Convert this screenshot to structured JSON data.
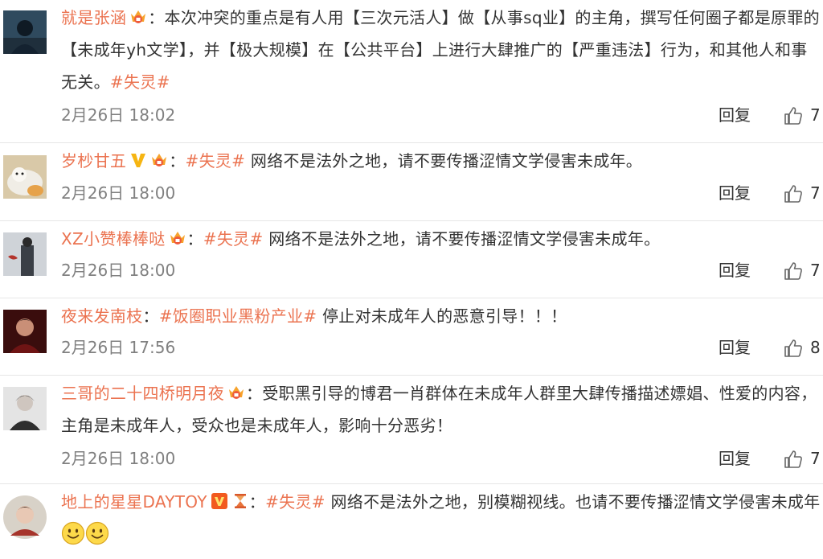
{
  "colors": {
    "username": "#eb7350",
    "topic": "#eb7350",
    "text": "#333333",
    "time": "#808080",
    "divider": "#e6e6e6"
  },
  "comments": [
    {
      "username": "就是张涵",
      "badges": [
        "fan-crown-badge"
      ],
      "separator": "：",
      "text_before": "本次冲突的重点是有人用【三次元活人】做【从事sq业】的主角，撰写任何圈子都是原罪的【未成年yh文学】，并【极大规模】在【公共平台】上进行大肆推广的【严重违法】行为，和其他人和事无关。",
      "topic": "#失灵#",
      "text_after": "",
      "time": "2月26日 18:02",
      "reply_label": "回复",
      "likes": "7"
    },
    {
      "username": "岁杪甘五",
      "badges": [
        "verified-v-badge",
        "fan-crown-badge"
      ],
      "separator": "：",
      "text_before": "",
      "topic": "#失灵#",
      "text_after": " 网络不是法外之地，请不要传播涩情文学侵害未成年。",
      "time": "2月26日 18:00",
      "reply_label": "回复",
      "likes": "7"
    },
    {
      "username": "XZ小赞棒棒哒",
      "badges": [
        "fan-crown-badge"
      ],
      "separator": "：",
      "text_before": "",
      "topic": "#失灵#",
      "text_after": " 网络不是法外之地，请不要传播涩情文学侵害未成年。",
      "time": "2月26日 18:00",
      "reply_label": "回复",
      "likes": "7"
    },
    {
      "username": "夜来发南枝",
      "badges": [],
      "separator": "：",
      "text_before": "",
      "topic": "#饭圈职业黑粉产业#",
      "text_after": " 停止对未成年人的恶意引导！！！",
      "time": "2月26日 17:56",
      "reply_label": "回复",
      "likes": "8"
    },
    {
      "username": "三哥的二十四桥明月夜",
      "badges": [
        "fan-crown-badge"
      ],
      "separator": "：",
      "text_before": "受职黑引导的博君一肖群体在未成年人群里大肆传播描述嫖娼、性爱的内容，主角是未成年人，受众也是未成年人，影响十分恶劣！",
      "topic": "",
      "text_after": "",
      "time": "2月26日 18:00",
      "reply_label": "回复",
      "likes": "7"
    },
    {
      "username": "地上的星星DAYTOY",
      "badges": [
        "verified-v-box-badge",
        "hourglass-badge"
      ],
      "separator": "：",
      "text_before": "",
      "topic": "#失灵#",
      "text_after": " 网络不是法外之地，别模糊视线。也请不要传播涩情文学侵害未成年",
      "emoji": [
        "smile-emoji",
        "smile-emoji"
      ]
    }
  ]
}
